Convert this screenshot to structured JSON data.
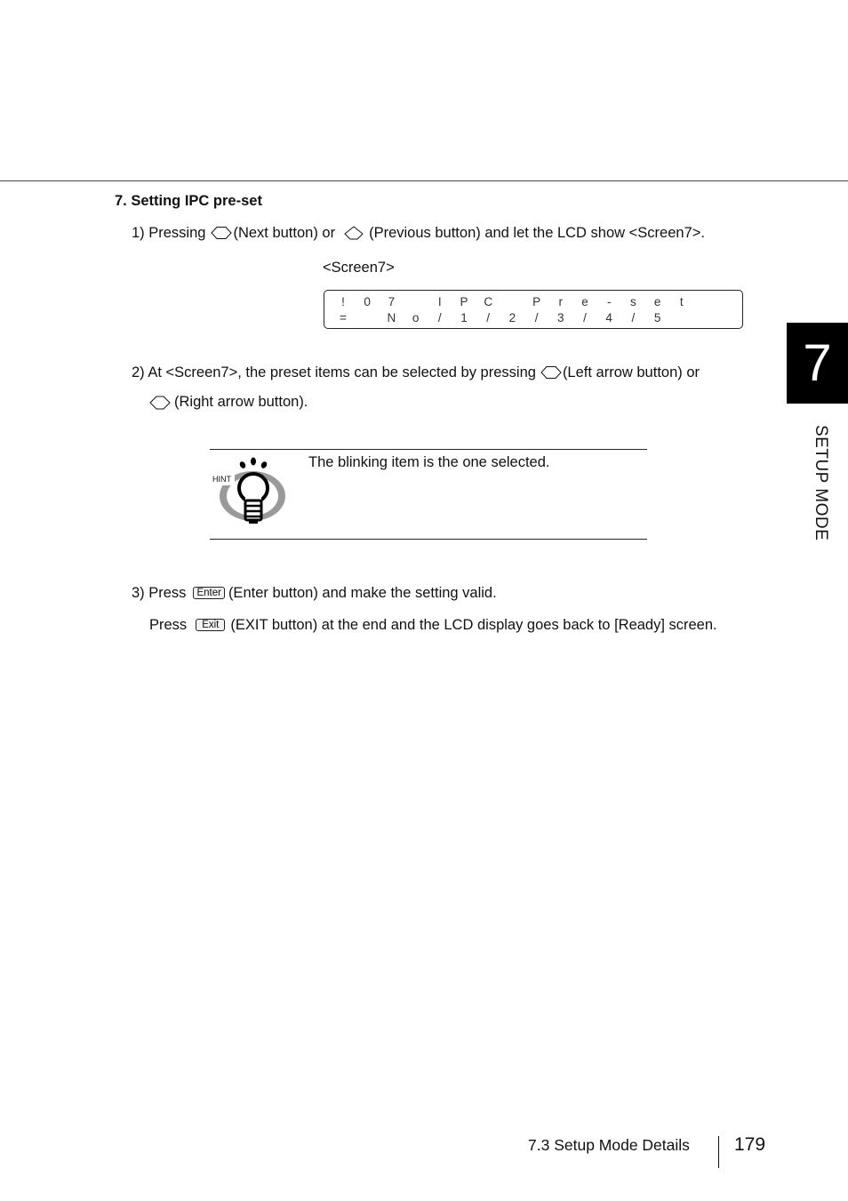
{
  "section": {
    "title": "7. Setting IPC pre-set"
  },
  "steps": {
    "step1": {
      "prefix": "1) Pressing",
      "next_button_label": "(Next button) or",
      "prev_button_label": "(Previous button) and let the LCD show <Screen7>.",
      "icons": [
        "next-button-icon",
        "previous-button-icon"
      ]
    },
    "screen_label": "<Screen7>",
    "step2": {
      "line1_prefix": "2) At <Screen7>, the preset items can be selected by pressing",
      "left_label": "(Left arrow button) or",
      "right_label": "(Right arrow button).",
      "icons": [
        "left-arrow-button-icon",
        "right-arrow-button-icon"
      ]
    },
    "step3": {
      "prefix": "3) Press",
      "enter_key": "Enter",
      "enter_text": "(Enter button) and make the setting valid.",
      "press2": "Press",
      "exit_key": "Exit",
      "exit_text": "(EXIT button) at the end and the LCD display goes back to [Ready] screen."
    }
  },
  "lcd": {
    "row1": [
      "!",
      "0",
      "7",
      " ",
      "I",
      "P",
      "C",
      " ",
      "P",
      "r",
      "e",
      "-",
      "s",
      "e",
      "t",
      " "
    ],
    "row2": [
      "=",
      " ",
      "N",
      "o",
      "/",
      "1",
      "/",
      "2",
      "/",
      "3",
      "/",
      "4",
      "/",
      "5",
      " ",
      " "
    ]
  },
  "hint": {
    "badge": "HINT",
    "text": "The blinking item is the one selected."
  },
  "chapter": {
    "number": "7",
    "label": "SETUP MODE"
  },
  "footer": {
    "section": "7.3  Setup Mode Details",
    "page": "179"
  }
}
